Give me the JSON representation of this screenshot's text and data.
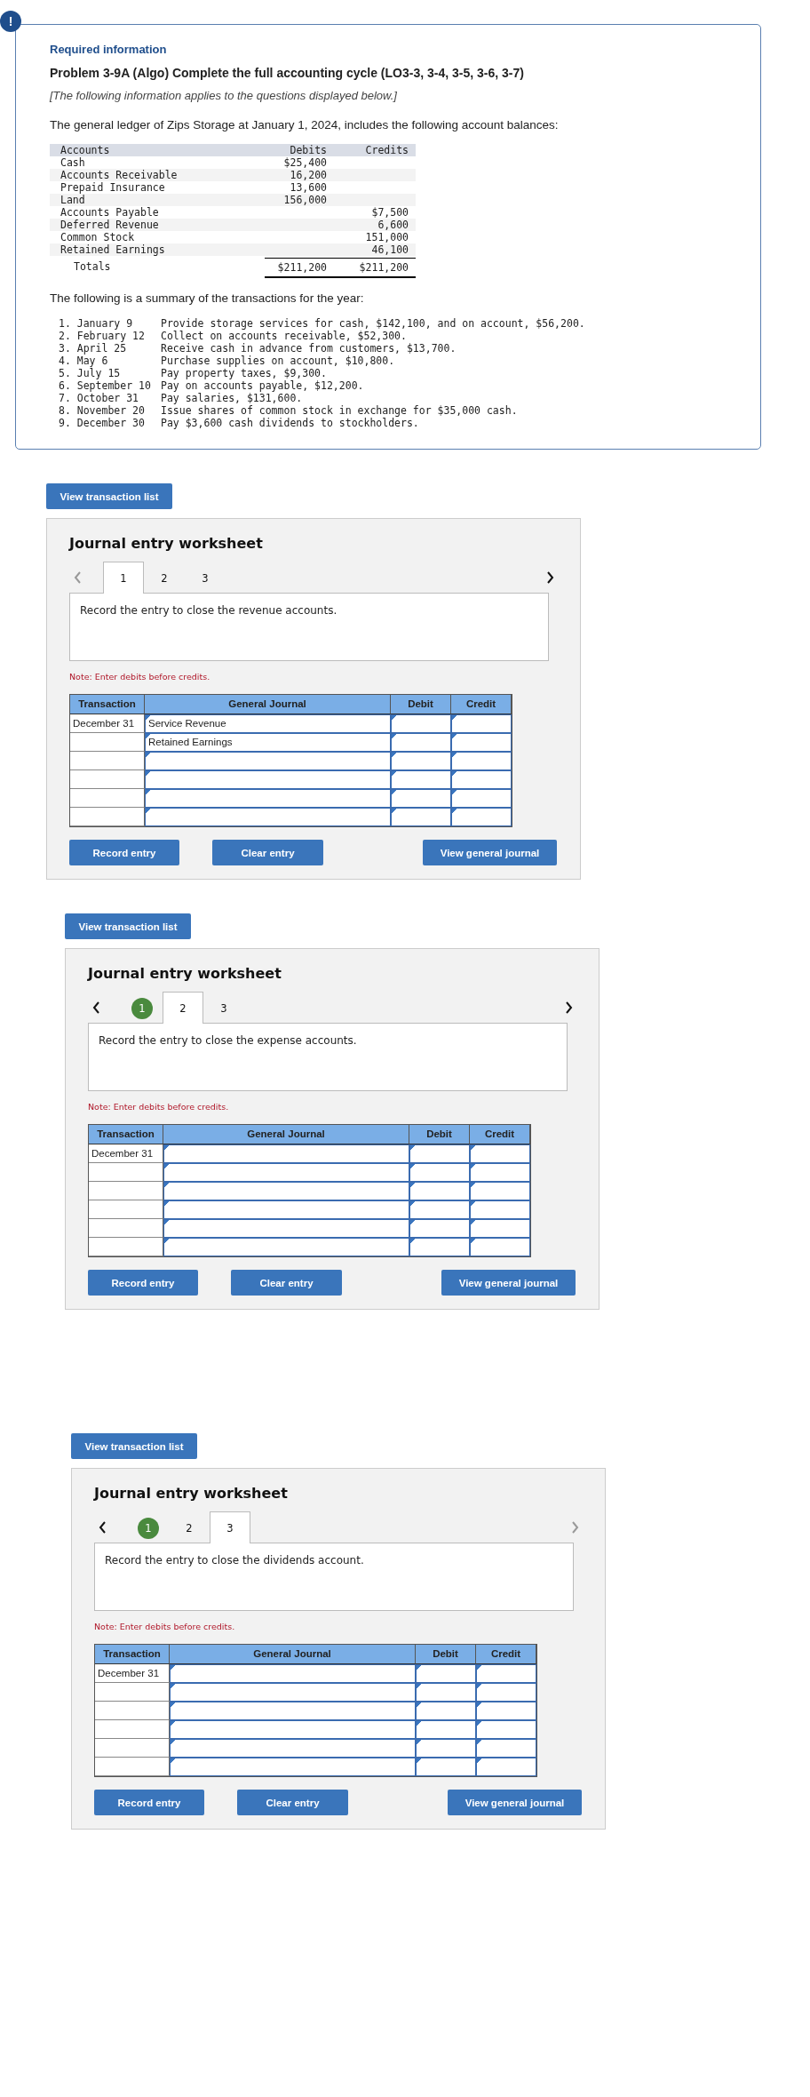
{
  "alert": "!",
  "info": {
    "heading": "Required information",
    "title": "Problem 3-9A (Algo) Complete the full accounting cycle (LO3-3, 3-4, 3-5, 3-6, 3-7)",
    "note": "[The following information applies to the questions displayed below.]",
    "intro": "The general ledger of Zips Storage at January 1, 2024, includes the following account balances:",
    "ledger": {
      "columns": [
        "Accounts",
        "Debits",
        "Credits"
      ],
      "rows": [
        {
          "account": "Cash",
          "debit": "$25,400"
        },
        {
          "account": "Accounts Receivable",
          "debit": "16,200"
        },
        {
          "account": "Prepaid Insurance",
          "debit": "13,600"
        },
        {
          "account": "Land",
          "debit": "156,000"
        },
        {
          "account": "Accounts Payable",
          "credit": "$7,500"
        },
        {
          "account": "Deferred Revenue",
          "credit": "6,600"
        },
        {
          "account": "Common Stock",
          "credit": "151,000"
        },
        {
          "account": "Retained Earnings",
          "credit": "46,100"
        }
      ],
      "totals": {
        "label": "Totals",
        "debit": "$211,200",
        "credit": "$211,200"
      }
    },
    "summary_intro": "The following is a summary of the transactions for the year:",
    "transactions": [
      {
        "date": "1. January 9",
        "description": "Provide storage services for cash, $142,100, and on account, $56,200."
      },
      {
        "date": "2. February 12",
        "description": "Collect on accounts receivable, $52,300."
      },
      {
        "date": "3. April 25",
        "description": "Receive cash in advance from customers, $13,700."
      },
      {
        "date": "4. May 6",
        "description": "Purchase supplies on account, $10,800."
      },
      {
        "date": "5. July 15",
        "description": "Pay property taxes, $9,300."
      },
      {
        "date": "6. September 10",
        "description": "Pay on accounts payable, $12,200."
      },
      {
        "date": "7. October 31",
        "description": "Pay salaries, $131,600."
      },
      {
        "date": "8. November 20",
        "description": "Issue shares of common stock in exchange for $35,000 cash."
      },
      {
        "date": "9. December 30",
        "description": "Pay $3,600 cash dividends to stockholders."
      }
    ]
  },
  "worksheets": [
    {
      "button": "View transaction list",
      "title": "Journal entry worksheet",
      "prev": {
        "disabled": true
      },
      "next": {
        "disabled": false
      },
      "tabs": [
        {
          "label": "1",
          "selected": true,
          "done": false
        },
        {
          "label": "2",
          "selected": false,
          "done": false
        },
        {
          "label": "3",
          "selected": false,
          "done": false
        }
      ],
      "prompt": "Record the entry to close the revenue accounts.",
      "note": "Note: Enter debits before credits.",
      "columns": [
        "Transaction",
        "General Journal",
        "Debit",
        "Credit"
      ],
      "rows": [
        {
          "transaction": "December 31",
          "account": "Service Revenue"
        },
        {
          "account": "Retained Earnings"
        },
        {},
        {},
        {},
        {}
      ],
      "actions": [
        "Record entry",
        "Clear entry",
        "View general journal"
      ]
    },
    {
      "button": "View transaction list",
      "title": "Journal entry worksheet",
      "prev": {
        "disabled": false
      },
      "next": {
        "disabled": false
      },
      "tabs": [
        {
          "label": "1",
          "selected": false,
          "done": true
        },
        {
          "label": "2",
          "selected": true,
          "done": false
        },
        {
          "label": "3",
          "selected": false,
          "done": false
        }
      ],
      "prompt": "Record the entry to close the expense accounts.",
      "note": "Note: Enter debits before credits.",
      "columns": [
        "Transaction",
        "General Journal",
        "Debit",
        "Credit"
      ],
      "rows": [
        {
          "transaction": "December 31"
        },
        {},
        {},
        {},
        {},
        {}
      ],
      "actions": [
        "Record entry",
        "Clear entry",
        "View general journal"
      ]
    },
    {
      "button": "View transaction list",
      "title": "Journal entry worksheet",
      "prev": {
        "disabled": false
      },
      "next": {
        "disabled": true
      },
      "tabs": [
        {
          "label": "1",
          "selected": false,
          "done": true
        },
        {
          "label": "2",
          "selected": false,
          "done": false
        },
        {
          "label": "3",
          "selected": true,
          "done": false
        }
      ],
      "prompt": "Record the entry to close the dividends account.",
      "note": "Note: Enter debits before credits.",
      "columns": [
        "Transaction",
        "General Journal",
        "Debit",
        "Credit"
      ],
      "rows": [
        {
          "transaction": "December 31"
        },
        {},
        {},
        {},
        {},
        {}
      ],
      "actions": [
        "Record entry",
        "Clear entry",
        "View general journal"
      ]
    }
  ]
}
